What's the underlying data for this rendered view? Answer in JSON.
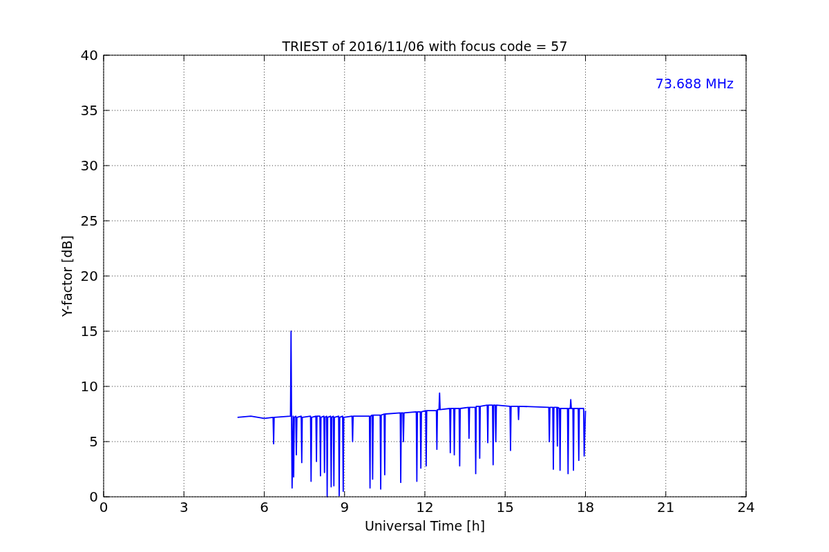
{
  "chart_data": {
    "type": "line",
    "title": "TRIEST of 2016/11/06 with focus code = 57",
    "xlabel": "Universal Time [h]",
    "ylabel": "Y-factor [dB]",
    "xlim": [
      0,
      24
    ],
    "ylim": [
      0,
      40
    ],
    "xticks": [
      0,
      3,
      6,
      9,
      12,
      15,
      18,
      21,
      24
    ],
    "yticks": [
      0,
      5,
      10,
      15,
      20,
      25,
      30,
      35,
      40
    ],
    "x": [
      5.0,
      5.5,
      6.0,
      6.33,
      6.35,
      6.37,
      6.98,
      7.0,
      7.02,
      7.04,
      7.08,
      7.1,
      7.12,
      7.18,
      7.2,
      7.22,
      7.38,
      7.4,
      7.42,
      7.73,
      7.75,
      7.77,
      7.93,
      7.95,
      7.97,
      8.08,
      8.1,
      8.12,
      8.23,
      8.25,
      8.27,
      8.33,
      8.35,
      8.37,
      8.48,
      8.5,
      8.52,
      8.58,
      8.6,
      8.62,
      8.78,
      8.8,
      8.82,
      8.93,
      8.95,
      8.97,
      9.28,
      9.3,
      9.32,
      9.93,
      9.95,
      9.97,
      10.03,
      10.05,
      10.07,
      10.33,
      10.35,
      10.37,
      10.48,
      10.5,
      10.52,
      11.08,
      11.1,
      11.12,
      11.18,
      11.2,
      11.22,
      11.68,
      11.7,
      11.72,
      11.83,
      11.85,
      11.87,
      12.03,
      12.05,
      12.07,
      12.43,
      12.45,
      12.47,
      12.53,
      12.55,
      12.57,
      12.93,
      12.95,
      12.97,
      13.08,
      13.1,
      13.12,
      13.28,
      13.3,
      13.32,
      13.63,
      13.65,
      13.67,
      13.88,
      13.9,
      13.92,
      14.03,
      14.05,
      14.07,
      14.33,
      14.35,
      14.37,
      14.53,
      14.55,
      14.57,
      14.63,
      14.65,
      14.67,
      15.18,
      15.2,
      15.22,
      15.48,
      15.5,
      15.52,
      16.63,
      16.65,
      16.67,
      16.78,
      16.8,
      16.82,
      16.93,
      16.95,
      16.97,
      17.03,
      17.05,
      17.07,
      17.33,
      17.35,
      17.37,
      17.43,
      17.45,
      17.47,
      17.53,
      17.55,
      17.57,
      17.73,
      17.75,
      17.77,
      17.93,
      17.95,
      18.0
    ],
    "series": [
      {
        "color": "#0000ff",
        "values": [
          7.2,
          7.3,
          7.1,
          7.2,
          4.8,
          7.2,
          7.3,
          15.0,
          7.2,
          0.8,
          7.3,
          1.8,
          7.2,
          7.3,
          3.8,
          7.2,
          7.3,
          3.1,
          7.2,
          7.3,
          1.4,
          7.2,
          7.3,
          3.2,
          7.3,
          7.3,
          1.9,
          7.2,
          7.3,
          2.2,
          7.2,
          7.3,
          0.0,
          7.2,
          7.3,
          0.9,
          7.2,
          7.3,
          1.0,
          7.2,
          7.3,
          0.1,
          7.2,
          7.3,
          0.5,
          7.2,
          7.3,
          5.0,
          7.3,
          7.3,
          0.8,
          7.3,
          7.4,
          1.6,
          7.4,
          7.4,
          0.7,
          7.4,
          7.5,
          2.0,
          7.5,
          7.6,
          1.3,
          7.6,
          7.6,
          5.0,
          7.6,
          7.7,
          1.4,
          7.7,
          7.7,
          2.6,
          7.7,
          7.8,
          2.8,
          7.8,
          7.8,
          4.3,
          7.9,
          7.9,
          9.4,
          7.9,
          8.0,
          4.0,
          8.0,
          8.0,
          3.8,
          8.0,
          8.0,
          2.8,
          8.0,
          8.1,
          5.3,
          8.1,
          8.1,
          2.1,
          8.2,
          8.2,
          3.5,
          8.2,
          8.3,
          4.9,
          8.3,
          8.3,
          2.9,
          8.3,
          8.3,
          5.0,
          8.3,
          8.2,
          4.2,
          8.2,
          8.2,
          7.0,
          8.2,
          8.1,
          5.0,
          8.1,
          8.1,
          2.5,
          8.1,
          8.1,
          4.6,
          8.1,
          8.0,
          2.4,
          8.0,
          8.0,
          2.1,
          8.0,
          8.0,
          8.8,
          8.0,
          8.0,
          2.4,
          8.0,
          8.0,
          3.3,
          8.0,
          8.0,
          3.7,
          7.8
        ]
      }
    ],
    "grid": true,
    "annotations": [
      {
        "text": "73.688 MHz"
      }
    ]
  }
}
